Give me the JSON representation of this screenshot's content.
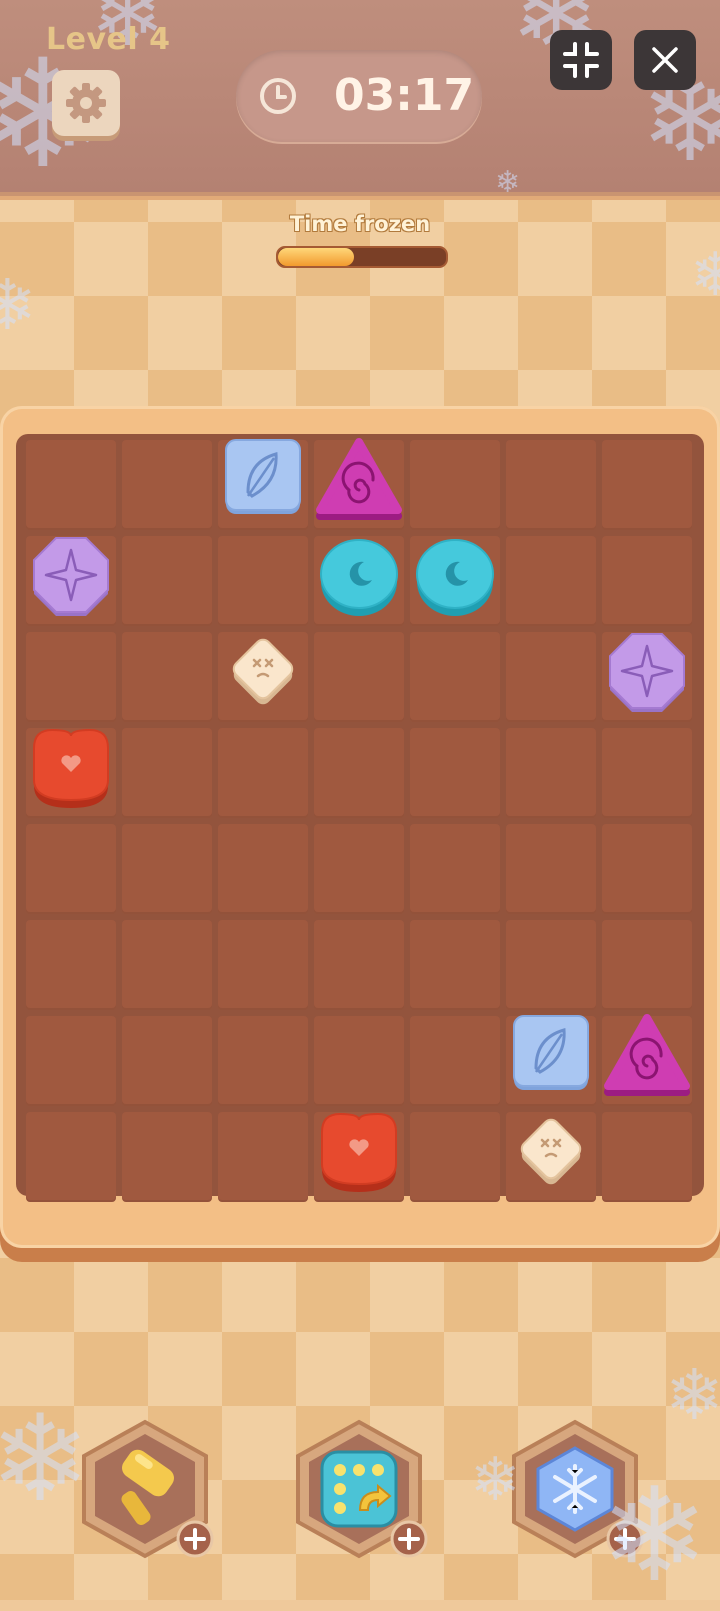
{
  "header": {
    "level_label": "Level 4",
    "timer": "03:17",
    "settings_icon": "gear-icon",
    "timer_icon": "clock-icon",
    "minimize_icon": "collapse-icon",
    "close_icon": "close-icon"
  },
  "freeze": {
    "label": "Time frozen",
    "progress": 0.45
  },
  "board": {
    "columns": 7,
    "rows": 8,
    "tiles": [
      {
        "kind": "blue-feather-square",
        "row": 0,
        "col": 2
      },
      {
        "kind": "pink-spiral-triangle",
        "row": 0,
        "col": 3
      },
      {
        "kind": "purple-compass-octagon",
        "row": 1,
        "col": 0
      },
      {
        "kind": "cyan-moon-circle",
        "row": 1,
        "col": 3
      },
      {
        "kind": "cyan-moon-circle",
        "row": 1,
        "col": 4
      },
      {
        "kind": "cream-cross-diamond",
        "row": 2,
        "col": 2
      },
      {
        "kind": "purple-compass-octagon",
        "row": 2,
        "col": 6
      },
      {
        "kind": "red-heart-rounded",
        "row": 3,
        "col": 0
      },
      {
        "kind": "blue-feather-square",
        "row": 6,
        "col": 5
      },
      {
        "kind": "pink-spiral-triangle",
        "row": 6,
        "col": 6
      },
      {
        "kind": "red-heart-rounded",
        "row": 7,
        "col": 3
      },
      {
        "kind": "cream-cross-diamond",
        "row": 7,
        "col": 5
      }
    ]
  },
  "boosters": [
    {
      "name": "hammer",
      "icon": "hammer-icon",
      "add_icon": "plus-icon"
    },
    {
      "name": "shuffle",
      "icon": "shuffle-icon",
      "add_icon": "plus-icon"
    },
    {
      "name": "freeze",
      "icon": "snowflake-icon",
      "add_icon": "plus-icon"
    }
  ]
}
